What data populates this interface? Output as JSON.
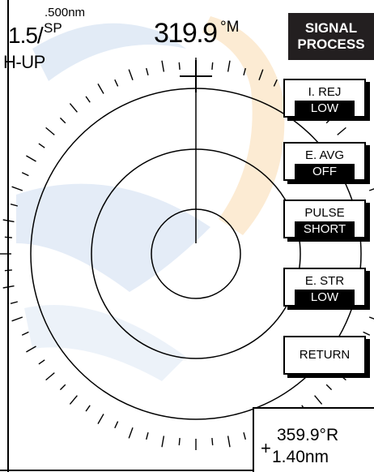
{
  "header": {
    "range": "1.5/",
    "ring_interval": ".500nm",
    "mode": "SP",
    "orientation": "H-UP",
    "heading": "319.9",
    "heading_unit": "°M"
  },
  "menu": {
    "title_line1": "SIGNAL",
    "title_line2": "PROCESS",
    "items": [
      {
        "label": "I. REJ",
        "value": "LOW"
      },
      {
        "label": "E. AVG",
        "value": "OFF"
      },
      {
        "label": "PULSE",
        "value": "SHORT"
      },
      {
        "label": "E. STR",
        "value": "LOW"
      },
      {
        "label": "RETURN"
      }
    ]
  },
  "cursor": {
    "bearing": "359.9°R",
    "range": "1.40nm",
    "marker": "+"
  },
  "colors": {
    "watermark_blue": "#b9cfe9",
    "watermark_orange": "#fbd9a8",
    "menu_title_bg": "#231f20"
  },
  "icons": {
    "heading_marker": "crosshair-plus-icon"
  }
}
